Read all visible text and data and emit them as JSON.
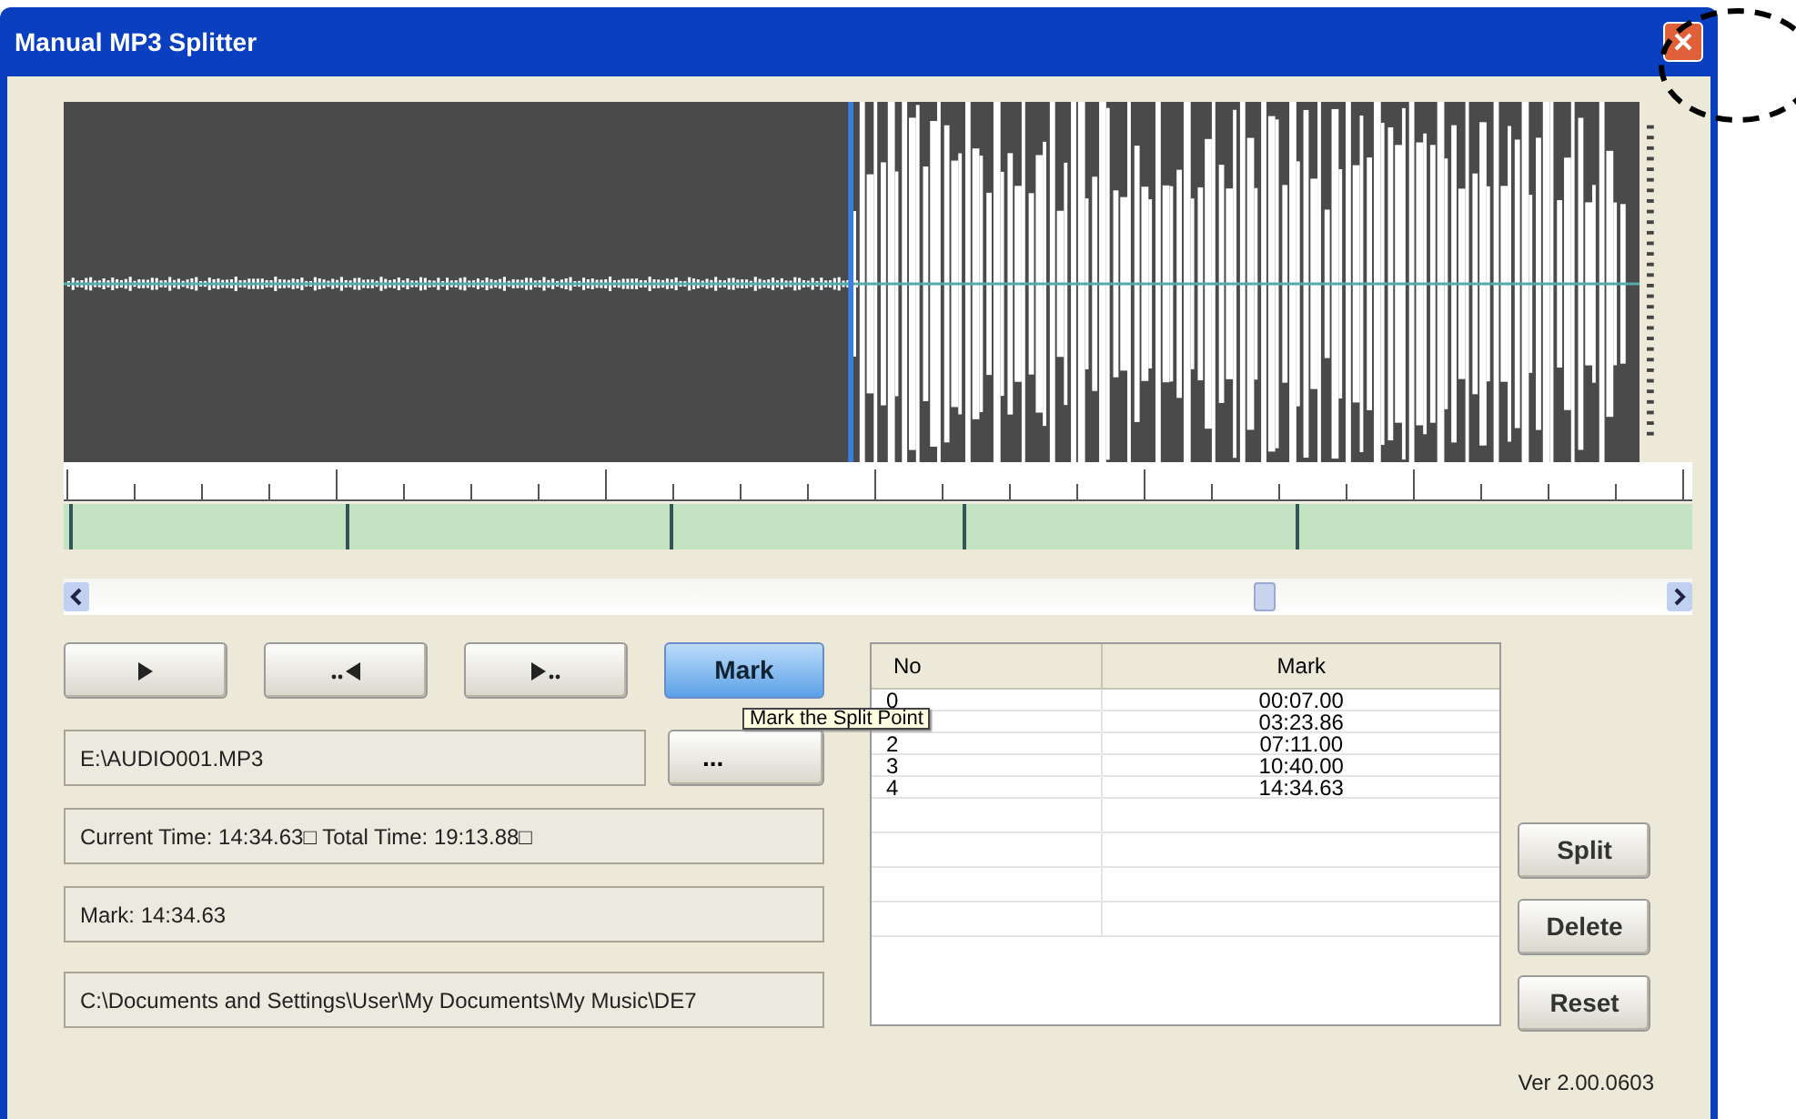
{
  "window": {
    "title": "Manual MP3 Splitter"
  },
  "transport_buttons": [
    {
      "kind": "play"
    },
    {
      "kind": "rewind"
    },
    {
      "kind": "forward"
    }
  ],
  "mark_button": {
    "label": "Mark",
    "selected": true
  },
  "file_field": {
    "value": "E:\\AUDIO001.MP3"
  },
  "browse_button": {
    "label": "..."
  },
  "tooltip": {
    "text": "Mark the Split Point"
  },
  "time_field": {
    "value": "Current Time: 14:34.63□ Total Time: 19:13.88□"
  },
  "mark_field": {
    "value": "Mark: 14:34.63"
  },
  "output_field": {
    "value": "C:\\Documents and Settings\\User\\My Documents\\My Music\\DE7"
  },
  "table": {
    "columns": [
      "No",
      "Mark"
    ],
    "rows": [
      {
        "no": "0",
        "mark": "00:07.00"
      },
      {
        "mark": "03:23.86"
      },
      {
        "no": "2",
        "mark": "07:11.00"
      },
      {
        "no": "3",
        "mark": "10:40.00"
      },
      {
        "no": "4",
        "mark": "14:34.63"
      }
    ]
  },
  "action_buttons": [
    "Split",
    "Delete",
    "Reset"
  ],
  "version": "Ver 2.00.0603"
}
